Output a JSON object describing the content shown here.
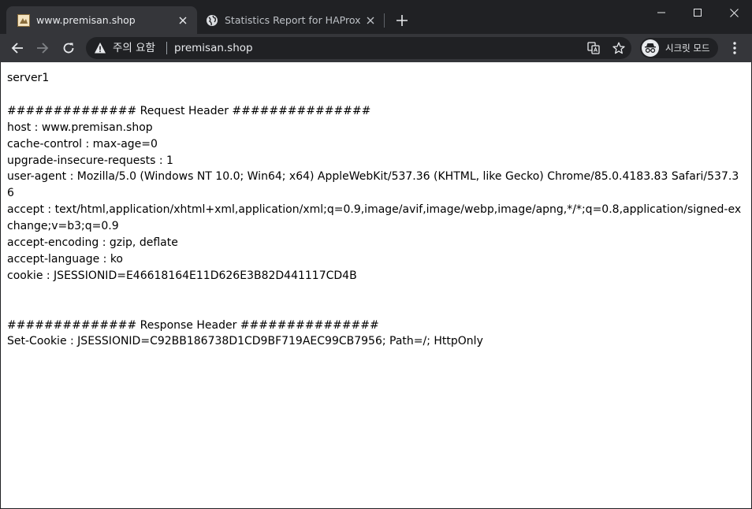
{
  "tabs": [
    {
      "title": "www.premisan.shop",
      "active": true,
      "favicon": "site-favicon"
    },
    {
      "title": "Statistics Report for HAProxy",
      "active": false,
      "favicon": "globe-icon"
    }
  ],
  "omnibox": {
    "security_label": "주의 요함",
    "url": "premisan.shop"
  },
  "profile": {
    "label": "시크릿 모드"
  },
  "colors": {
    "frame": "#202124",
    "toolbar": "#35363a",
    "text_light": "#e8eaed"
  },
  "page": {
    "server": "server1",
    "request_heading": "############## Request Header ###############",
    "request_headers": [
      "host : www.premisan.shop",
      "cache-control : max-age=0",
      "upgrade-insecure-requests : 1",
      "user-agent : Mozilla/5.0 (Windows NT 10.0; Win64; x64) AppleWebKit/537.36 (KHTML, like Gecko) Chrome/85.0.4183.83 Safari/537.36",
      "accept : text/html,application/xhtml+xml,application/xml;q=0.9,image/avif,image/webp,image/apng,*/*;q=0.8,application/signed-exchange;v=b3;q=0.9",
      "accept-encoding : gzip, deflate",
      "accept-language : ko",
      "cookie : JSESSIONID=E46618164E11D626E3B82D441117CD4B"
    ],
    "response_heading": "############## Response Header ###############",
    "response_headers": [
      "Set-Cookie : JSESSIONID=C92BB186738D1CD9BF719AEC99CB7956; Path=/; HttpOnly"
    ]
  }
}
